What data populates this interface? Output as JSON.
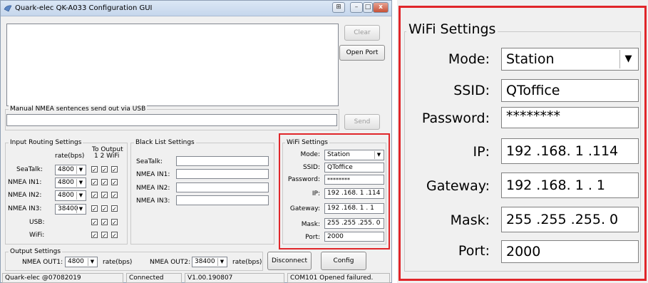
{
  "window": {
    "title": "Quark-elec QK-A033 Configuration GUI"
  },
  "buttons": {
    "clear": "Clear",
    "open_port": "Open Port",
    "send": "Send",
    "disconnect": "Disconnect",
    "config": "Config"
  },
  "manual": {
    "label": "Manual NMEA sentences send out via USB",
    "value": ""
  },
  "input_routing": {
    "title": "Input Routing Settings",
    "rate_header": "rate(bps)",
    "to_output_header": "To Output",
    "to_output_cols": "1  2  WiFi",
    "rows": [
      {
        "label": "SeaTalk:",
        "rate": "4800"
      },
      {
        "label": "NMEA IN1:",
        "rate": "4800"
      },
      {
        "label": "NMEA IN2:",
        "rate": "4800"
      },
      {
        "label": "NMEA IN3:",
        "rate": "38400"
      },
      {
        "label": "USB:",
        "rate": ""
      },
      {
        "label": "WiFi:",
        "rate": ""
      }
    ]
  },
  "black_list": {
    "title": "Black List Settings",
    "rows": [
      {
        "label": "SeaTalk:",
        "value": ""
      },
      {
        "label": "NMEA IN1:",
        "value": ""
      },
      {
        "label": "NMEA IN2:",
        "value": ""
      },
      {
        "label": "NMEA IN3:",
        "value": ""
      }
    ]
  },
  "wifi": {
    "title": "WiFi Settings",
    "mode_label": "Mode:",
    "mode": "Station",
    "ssid_label": "SSID:",
    "ssid": "QToffice",
    "password_label": "Password:",
    "password": "********",
    "ip_label": "IP:",
    "ip": "192 .168. 1 .114",
    "gateway_label": "Gateway:",
    "gateway": "192 .168. 1 . 1",
    "mask_label": "Mask:",
    "mask": "255 .255 .255. 0",
    "port_label": "Port:",
    "port": "2000"
  },
  "output": {
    "title": "Output Settings",
    "out1_label": "NMEA OUT1:",
    "out1_rate": "4800",
    "out2_label": "NMEA OUT2:",
    "out2_rate": "38400",
    "rate_unit": "rate(bps)"
  },
  "status": {
    "copyright": "Quark-elec @07082019",
    "connection": "Connected",
    "version": "V1.00.190807",
    "message": "COM101 Opened failured."
  },
  "colors": {
    "highlight": "#e0262a"
  }
}
